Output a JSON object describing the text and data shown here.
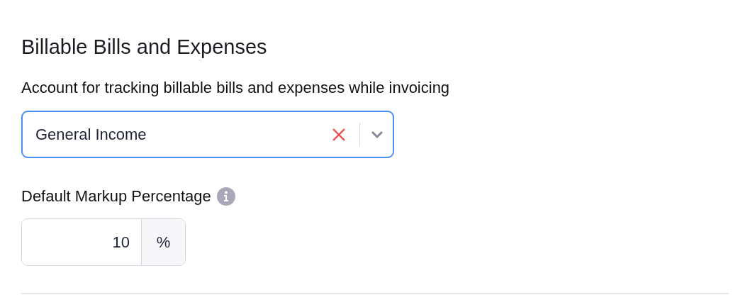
{
  "section": {
    "title": "Billable Bills and Expenses"
  },
  "account_field": {
    "label": "Account for tracking billable bills and expenses while invoicing",
    "value": "General Income",
    "focused": true
  },
  "markup_field": {
    "label": "Default Markup Percentage",
    "value": "10",
    "suffix": "%"
  }
}
